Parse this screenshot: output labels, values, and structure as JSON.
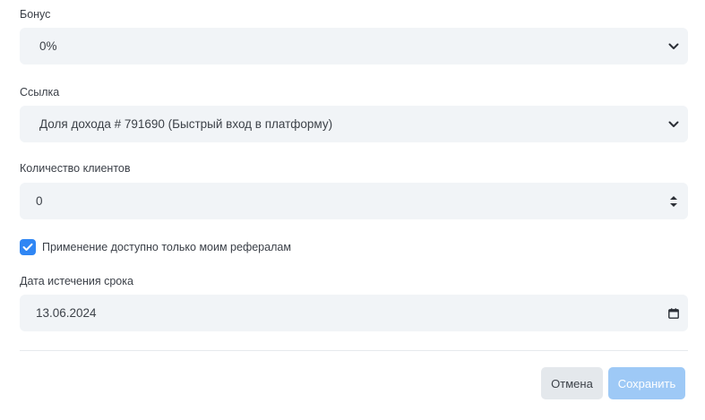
{
  "bonus": {
    "label": "Бонус",
    "value": "0%"
  },
  "link": {
    "label": "Ссылка",
    "value": "Доля дохода # 791690 (Быстрый вход в платформу)"
  },
  "clients": {
    "label": "Количество клиентов",
    "value": "0"
  },
  "referrals_only": {
    "label": "Применение доступно только моим рефералам",
    "checked": true
  },
  "expiry": {
    "label": "Дата истечения срока",
    "value": "13.06.2024"
  },
  "actions": {
    "cancel_label": "Отмена",
    "save_label": "Сохранить"
  },
  "colors": {
    "accent": "#2f86f4",
    "save_disabled": "#9ec9f6",
    "field_bg": "#f1f4f7"
  }
}
